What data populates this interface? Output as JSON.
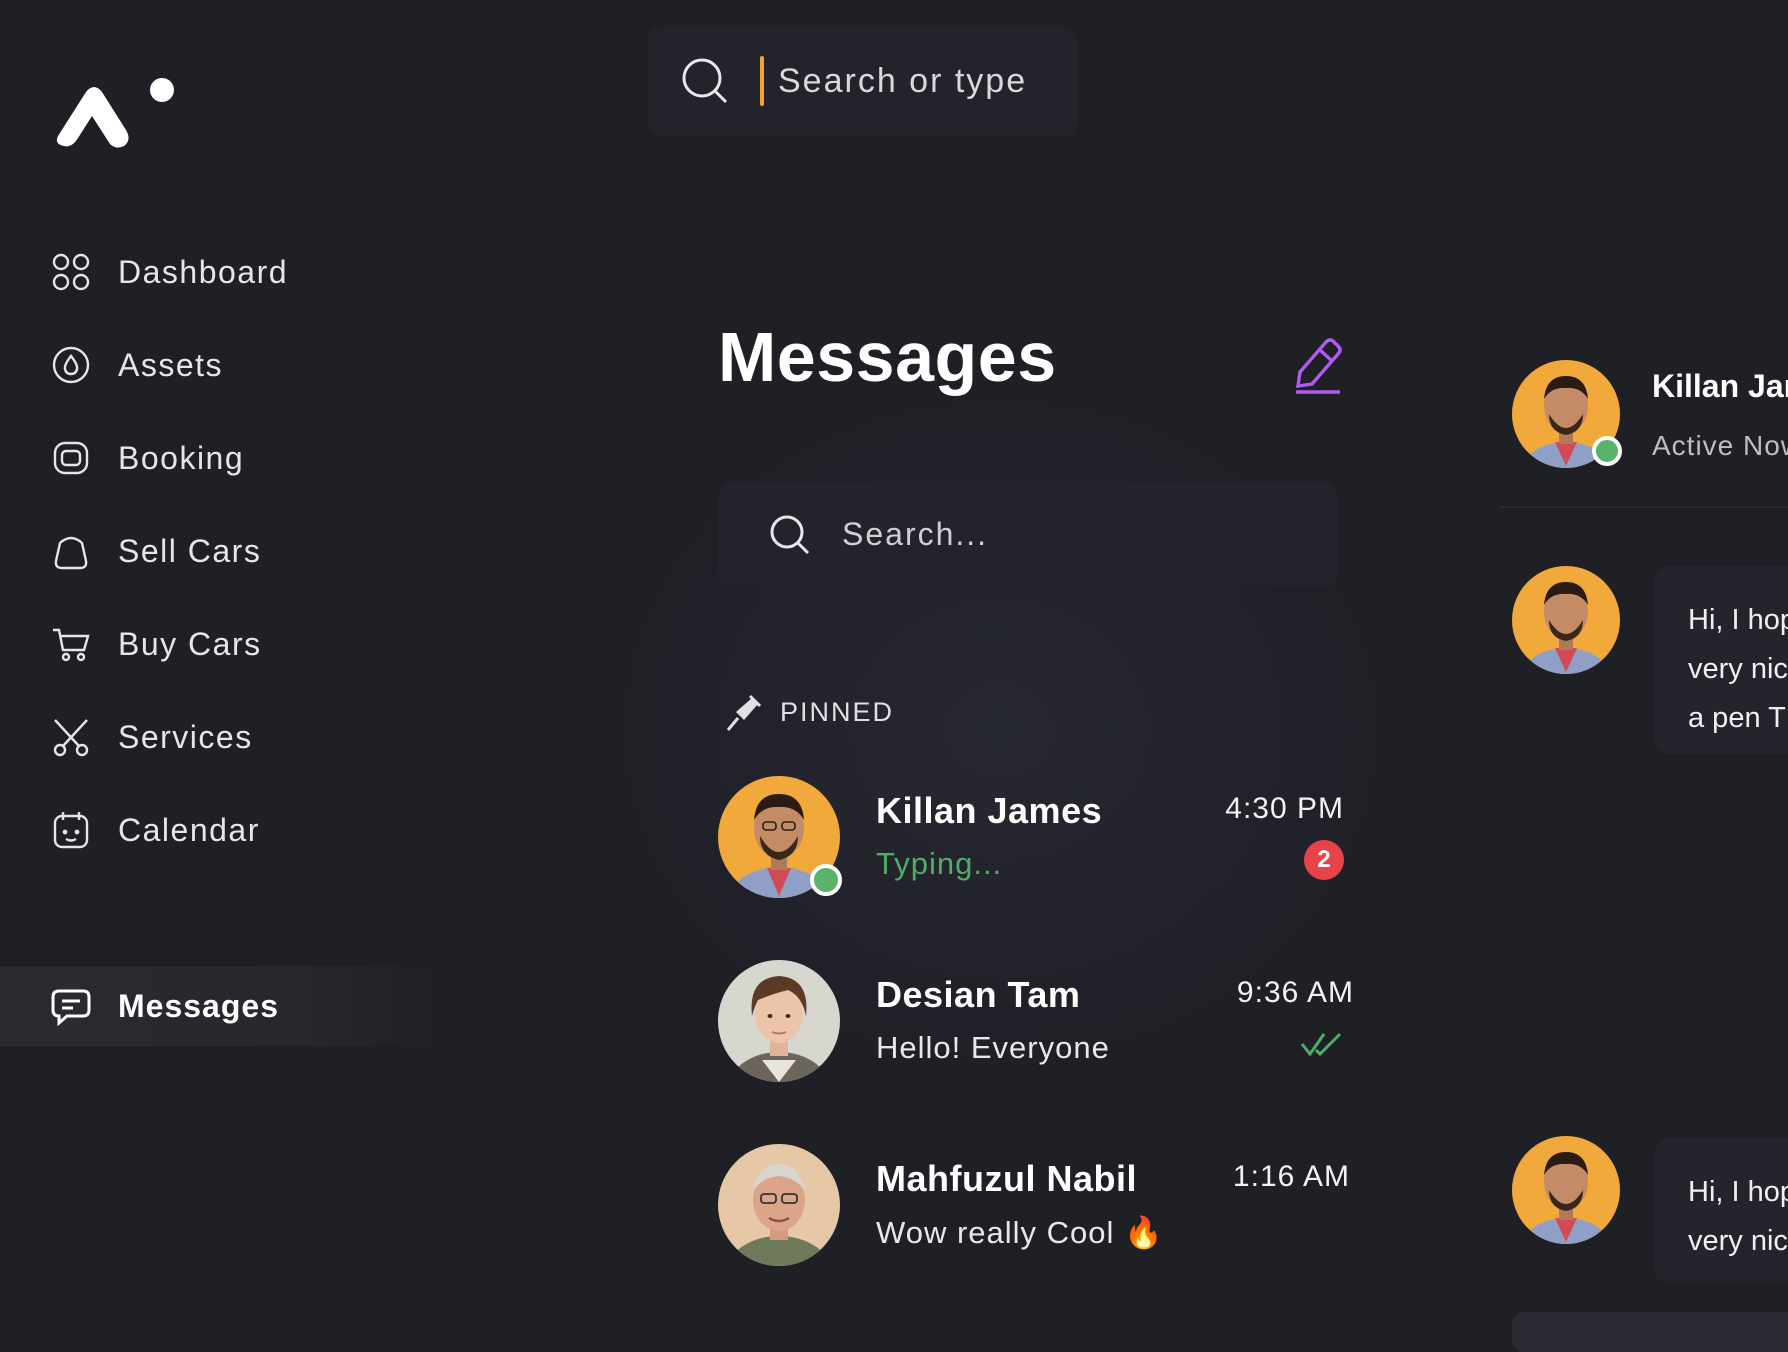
{
  "top_search": {
    "placeholder": "Search or type"
  },
  "sidebar": {
    "items": [
      {
        "label": "Dashboard",
        "icon": "dashboard-grid-icon",
        "active": false
      },
      {
        "label": "Assets",
        "icon": "assets-drop-icon",
        "active": false
      },
      {
        "label": "Booking",
        "icon": "booking-icon",
        "active": false
      },
      {
        "label": "Sell Cars",
        "icon": "shopping-bag-icon",
        "active": false
      },
      {
        "label": "Buy Cars",
        "icon": "cart-icon",
        "active": false
      },
      {
        "label": "Services",
        "icon": "scissors-icon",
        "active": false
      },
      {
        "label": "Calendar",
        "icon": "calendar-icon",
        "active": false
      },
      {
        "label": "Messages",
        "icon": "message-icon",
        "active": true
      }
    ]
  },
  "messages": {
    "title": "Messages",
    "search_placeholder": "Search...",
    "pinned_label": "PINNED",
    "compose_icon": "pen-edit-icon",
    "chats": [
      {
        "name": "Killan James",
        "preview": "Typing...",
        "time": "4:30 PM",
        "unread": "2",
        "online": true,
        "typing": true
      },
      {
        "name": "Desian Tam",
        "preview": "Hello! Everyone",
        "time": "9:36 AM",
        "read": true
      },
      {
        "name": "Mahfuzul Nabil",
        "preview": "Wow really Cool 🔥",
        "time": "1:16 AM"
      }
    ]
  },
  "conversation": {
    "name": "Killan James",
    "status": "Active Now",
    "messages": [
      {
        "text_lines": [
          "Hi, I hope",
          "very nice",
          "a pen T"
        ]
      },
      {
        "text_lines": [
          "Hi, I hope",
          "very nice"
        ]
      }
    ]
  },
  "colors": {
    "background": "#1f1f26",
    "panel": "#23232b",
    "accent_caret": "#f0a23a",
    "typing": "#4fae66",
    "badge": "#e8424a",
    "compose": "#b05cf0",
    "online": "#59b36a"
  }
}
